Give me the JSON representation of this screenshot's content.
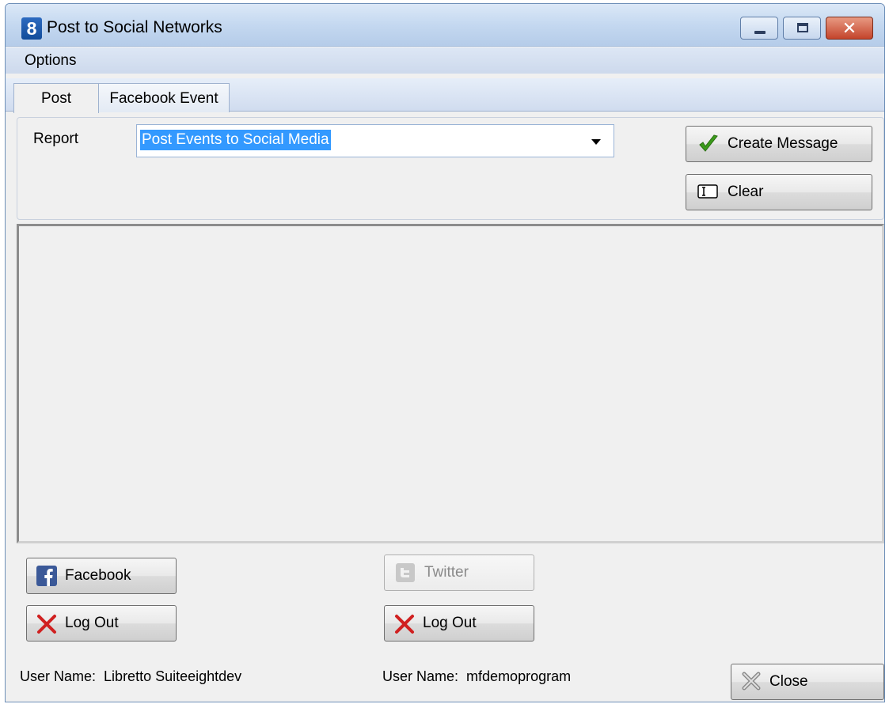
{
  "window": {
    "app_icon_text": "8",
    "title": "Post to Social Networks"
  },
  "menu": {
    "items": [
      "Options"
    ]
  },
  "tabs": [
    {
      "label": "Post",
      "active": true
    },
    {
      "label": "Facebook Event",
      "active": false
    }
  ],
  "report": {
    "label": "Report",
    "selected_value": "Post Events to Social Media"
  },
  "actions": {
    "create_message_label": "Create Message",
    "clear_label": "Clear"
  },
  "facebook": {
    "button_label": "Facebook",
    "logout_label": "Log Out",
    "user_name_label": "User Name:",
    "user_name_value": "Libretto Suiteeightdev"
  },
  "twitter": {
    "button_label": "Twitter",
    "logout_label": "Log Out",
    "user_name_label": "User Name:",
    "user_name_value": "mfdemoprogram"
  },
  "footer": {
    "close_label": "Close"
  },
  "colors": {
    "accent_blue": "#3399ff",
    "check_green": "#3b9b1a",
    "x_red": "#d02020",
    "facebook_blue": "#3b5998"
  }
}
